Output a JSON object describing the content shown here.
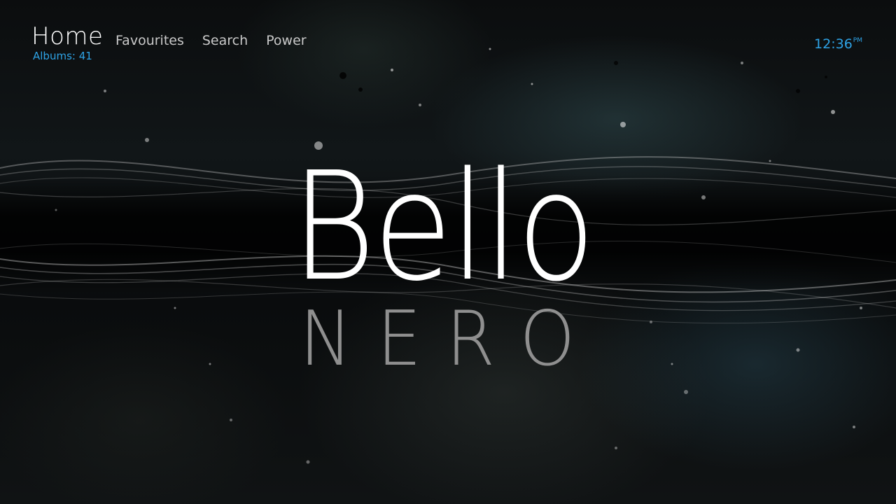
{
  "header": {
    "title": "Home",
    "subtitle": "Albums: 41"
  },
  "nav": {
    "items": [
      "Favourites",
      "Search",
      "Power"
    ]
  },
  "clock": {
    "time": "12:36",
    "meridiem": "PM"
  },
  "logo": {
    "line1": "Bello",
    "line2": "NERO"
  },
  "colors": {
    "accent": "#2ea3e6",
    "text": "#ffffff",
    "nav_text": "#c9c9c9",
    "logo_secondary": "#8f8f8f"
  }
}
